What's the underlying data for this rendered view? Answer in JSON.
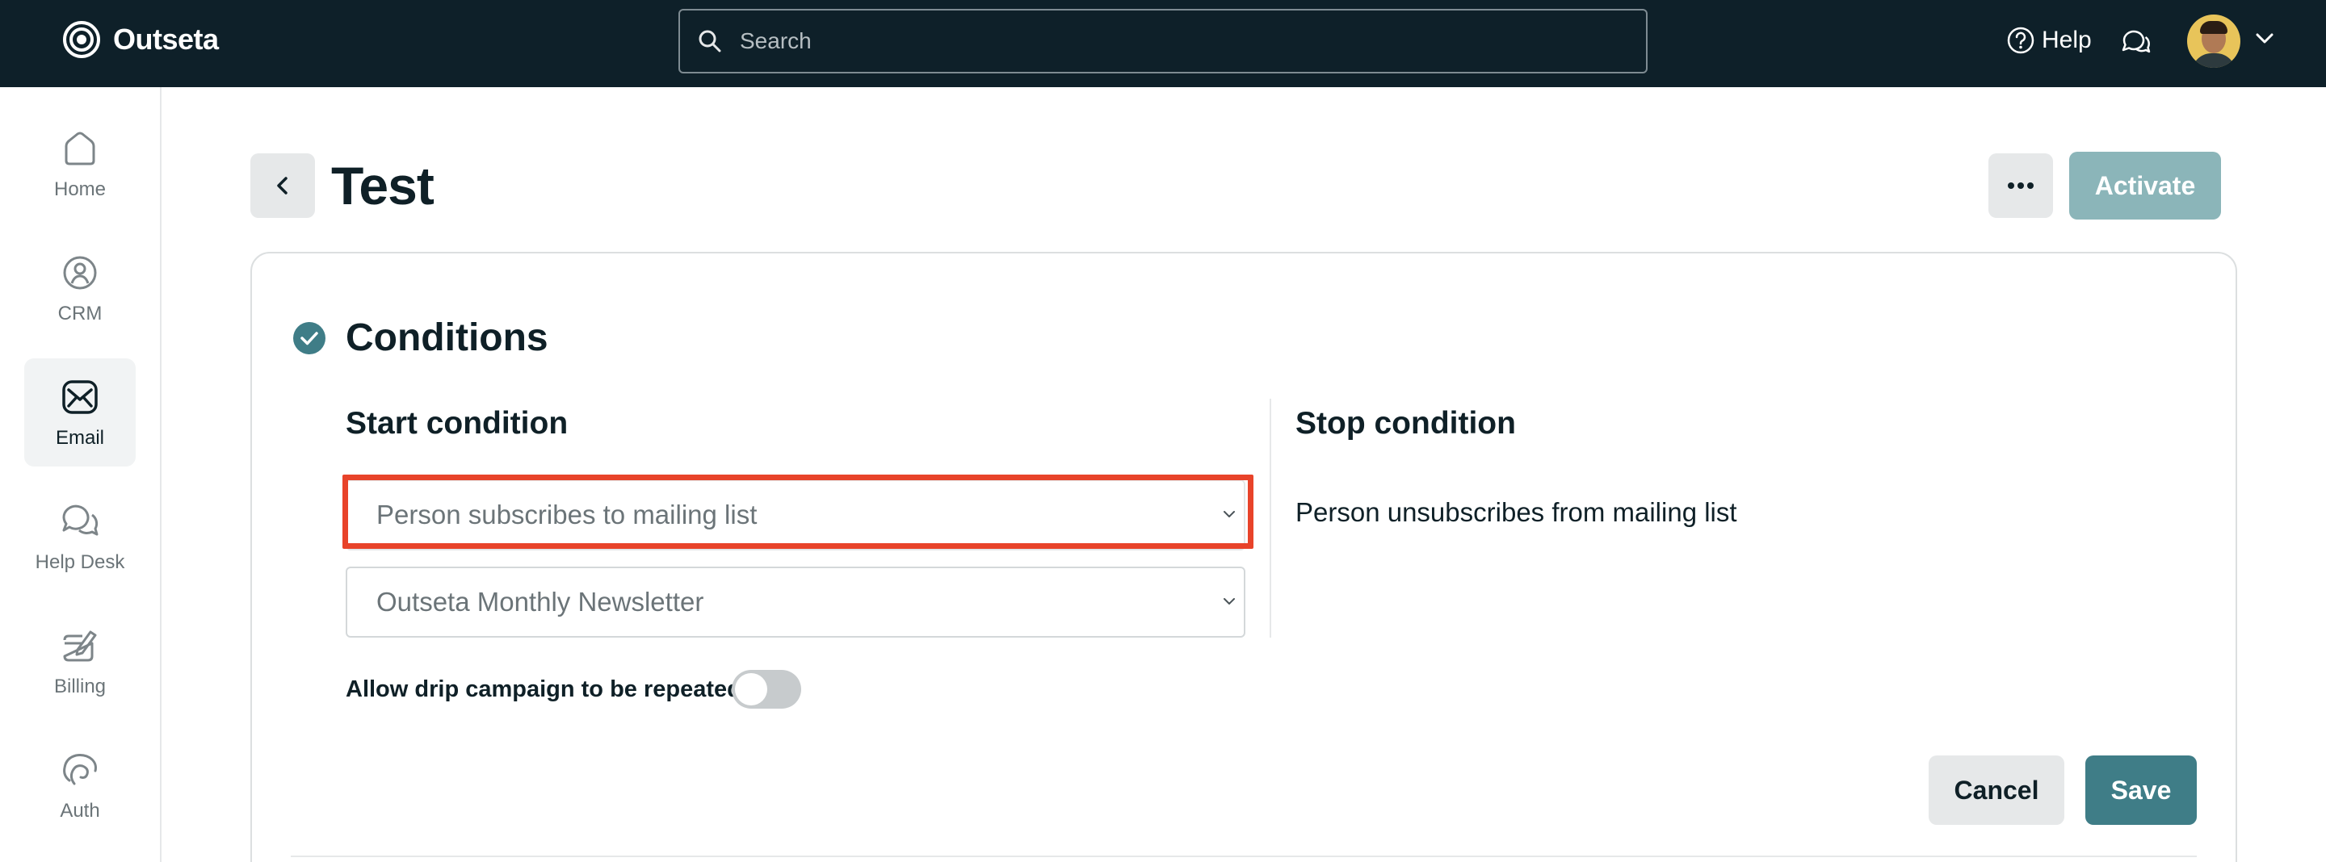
{
  "app": {
    "brand_name": "Outseta"
  },
  "topbar": {
    "search_placeholder": "Search",
    "help_label": "Help"
  },
  "sidebar": {
    "items": [
      {
        "label": "Home",
        "icon": "home-icon",
        "active": false
      },
      {
        "label": "CRM",
        "icon": "crm-icon",
        "active": false
      },
      {
        "label": "Email",
        "icon": "email-icon",
        "active": true
      },
      {
        "label": "Help Desk",
        "icon": "help-desk-icon",
        "active": false
      },
      {
        "label": "Billing",
        "icon": "billing-icon",
        "active": false
      },
      {
        "label": "Auth",
        "icon": "auth-icon",
        "active": false
      }
    ]
  },
  "header": {
    "title": "Test",
    "activate_label": "Activate"
  },
  "conditions": {
    "title": "Conditions",
    "start_title": "Start condition",
    "start_trigger": "Person subscribes to mailing list",
    "start_list": "Outseta Monthly Newsletter",
    "stop_title": "Stop condition",
    "stop_text": "Person unsubscribes from mailing list",
    "repeat_label": "Allow drip campaign to be repeated",
    "repeat_enabled": false,
    "cancel_label": "Cancel",
    "save_label": "Save"
  },
  "colors": {
    "topbar": "#0e2029",
    "accent": "#3f7d87",
    "activate_disabled": "#8bb5b9",
    "highlight": "#e8432a"
  }
}
